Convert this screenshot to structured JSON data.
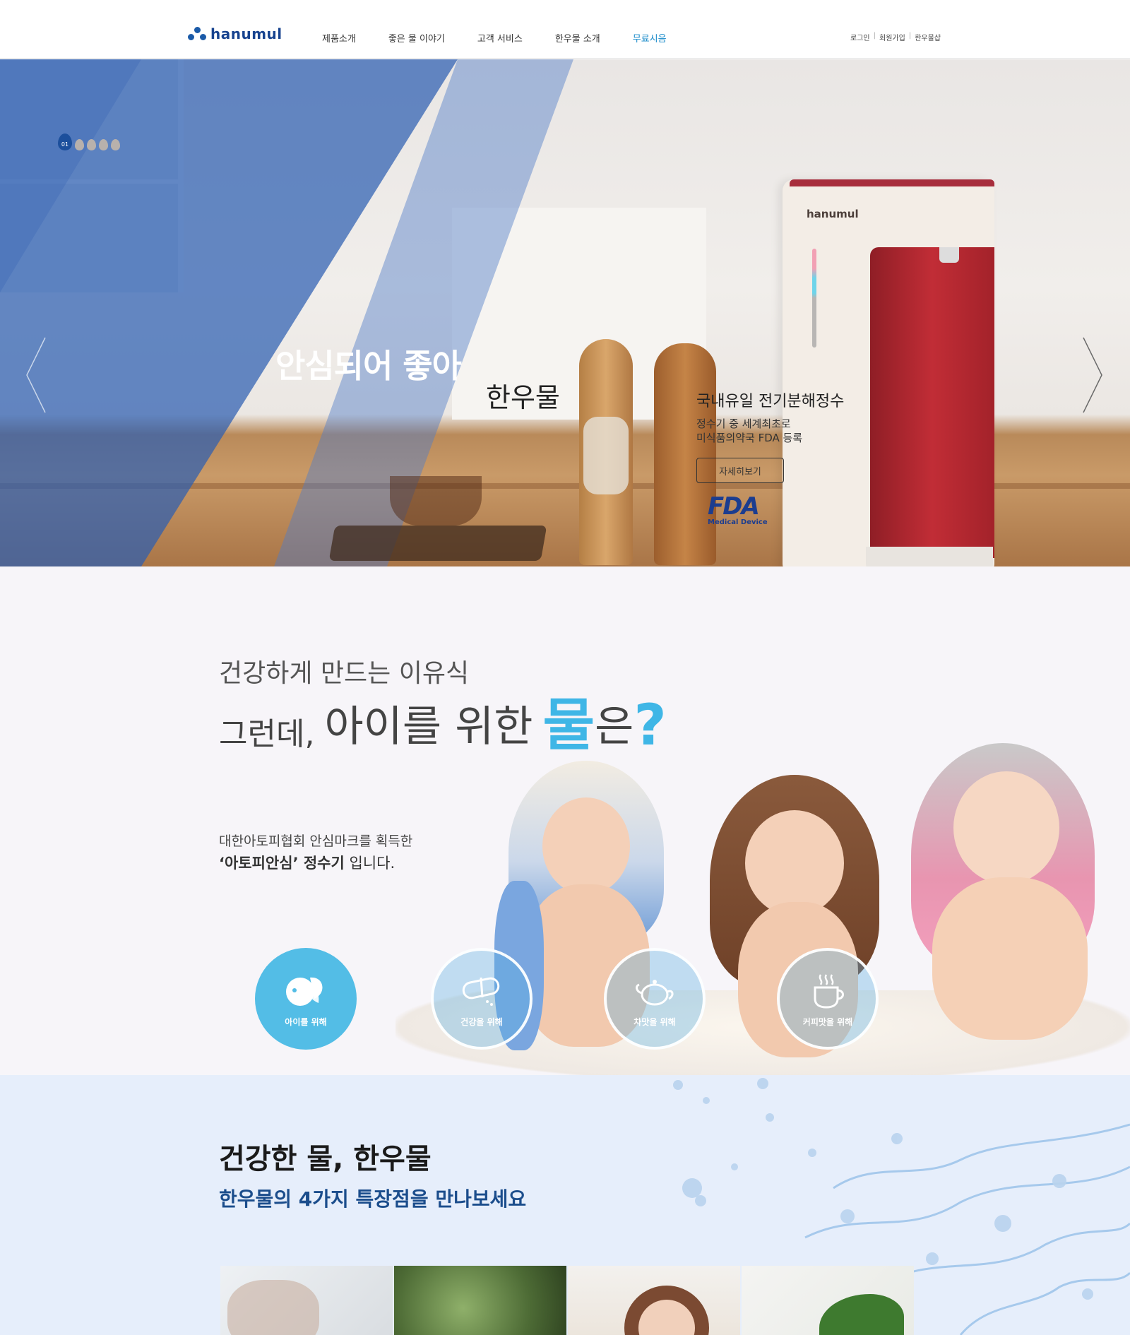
{
  "header": {
    "logo_text": "hanumul",
    "nav": [
      "제품소개",
      "좋은 물 이야기",
      "고객 서비스",
      "한우물 소개",
      "무료시음"
    ],
    "util": [
      "로그인",
      "회원가입",
      "한우물샵"
    ]
  },
  "hero": {
    "indicator": "01",
    "title1": "안심되어 좋아",
    "title2": "한우물",
    "sub1": "국내유일 전기분해정수",
    "sub2_line1": "정수기 중 세계최초로",
    "sub2_line2": "미식품의약국 FDA 등록",
    "button": "자세히보기",
    "fda_logo": "FDA",
    "fda_caption": "Medical Device",
    "product_brand": "hanumul"
  },
  "babies": {
    "line1": "건강하게 만드는 이유식",
    "line2_a": "그런데,",
    "line2_b": "아이를 위한",
    "line2_accent": "물",
    "line2_c": "은",
    "line2_q": "?",
    "desc1": "대한아토피협회 안심마크를 획득한",
    "desc2_bold": "‘아토피안심’ 정수기",
    "desc2_rest": " 입니다.",
    "circles": [
      {
        "label": "아이를 위해",
        "icon": "baby-leaf-icon"
      },
      {
        "label": "건강을 위해",
        "icon": "pill-icon"
      },
      {
        "label": "차맛을 위해",
        "icon": "teapot-icon"
      },
      {
        "label": "커피맛을 위해",
        "icon": "coffee-cup-icon"
      }
    ]
  },
  "features": {
    "title": "건강한 물, 한우물",
    "subtitle": "한우물의 4가지 특장점을 만나보세요"
  },
  "colors": {
    "accent": "#3fb6e6",
    "brand": "#17438f",
    "nav_active": "#1689c9"
  }
}
